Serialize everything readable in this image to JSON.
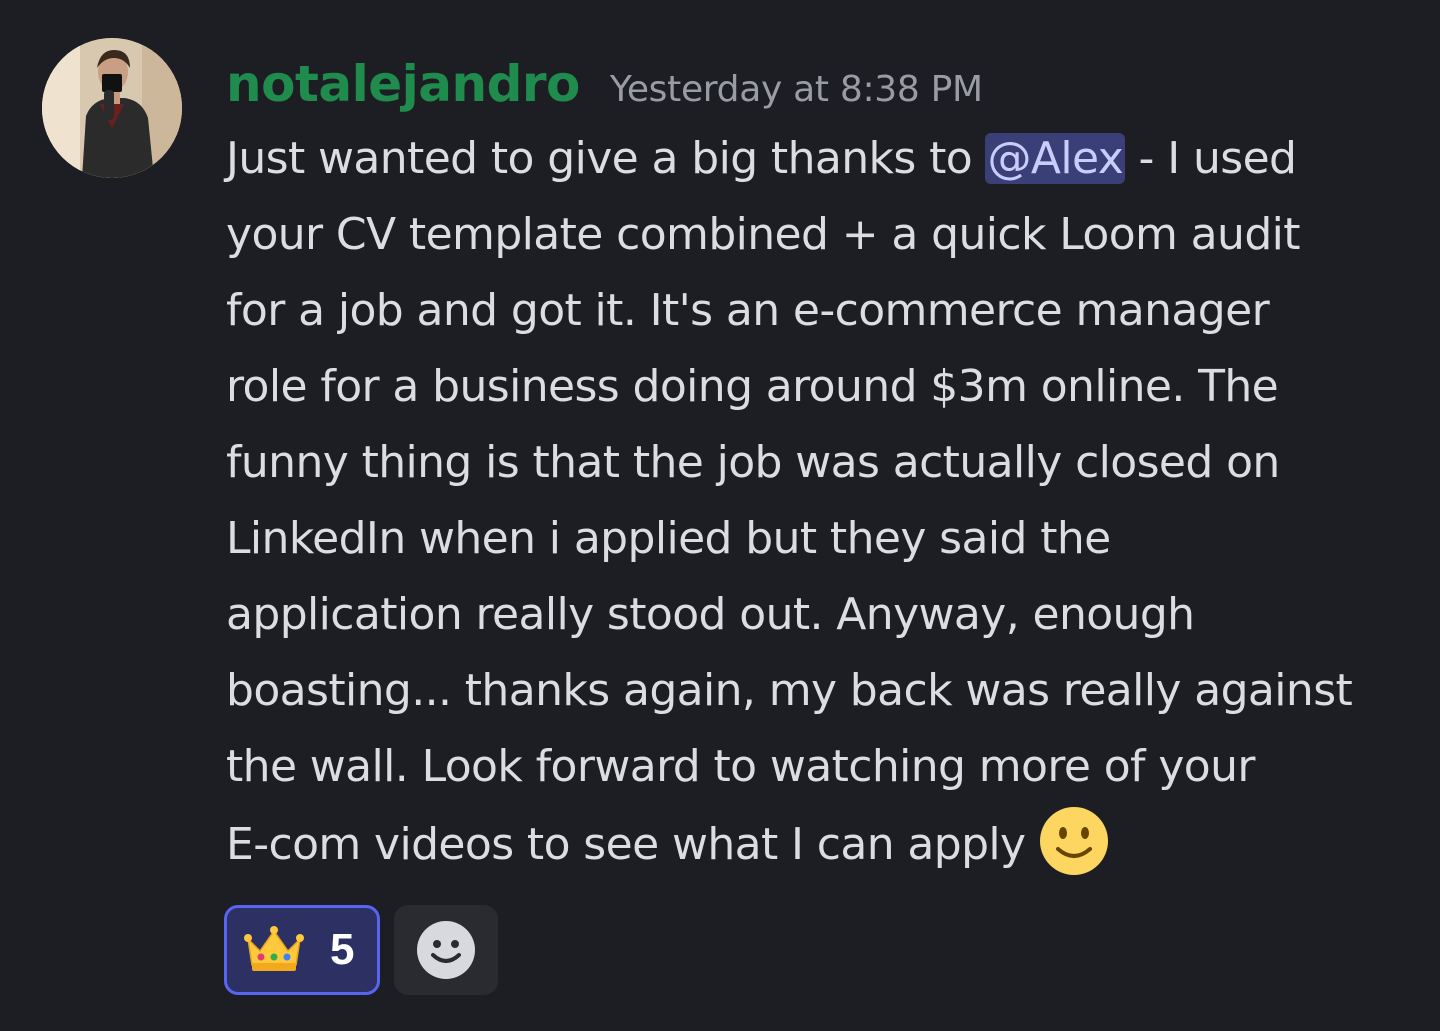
{
  "message": {
    "username": "notalejandro",
    "timestamp": "Yesterday at 8:38 PM",
    "avatar_icon": "user-avatar-photo",
    "lines": [
      {
        "before": "Just wanted to give a big thanks to ",
        "mention": "@Alex",
        "after": " - I used"
      },
      {
        "text": "your CV template combined +  a quick Loom audit"
      },
      {
        "text": "for a job and got it. It's an e-commerce manager"
      },
      {
        "text": "role for a business doing around $3m online.  The"
      },
      {
        "text": "funny thing is that the job was actually closed on"
      },
      {
        "text": "LinkedIn when i applied but they said the"
      },
      {
        "text": "application really stood out. Anyway, enough"
      },
      {
        "text": "boasting... thanks again, my back was really against"
      },
      {
        "text": "the wall. Look forward to watching more of your"
      },
      {
        "text": "E-com videos to see what I can apply"
      }
    ],
    "trailing_emoji": "slightly-smiling-face-icon"
  },
  "reactions": [
    {
      "icon": "crown-icon",
      "count": "5"
    }
  ],
  "add_reaction_icon": "add-reaction-smile-icon",
  "colors": {
    "background": "#1d1e24",
    "username": "#1f8b4c",
    "timestamp": "#9a9ca4",
    "text": "#dcdde2",
    "mention_bg": "#3b3f77",
    "mention_text": "#c9cdfb",
    "reaction_bg": "#2d3063",
    "reaction_border": "#5865f2"
  }
}
